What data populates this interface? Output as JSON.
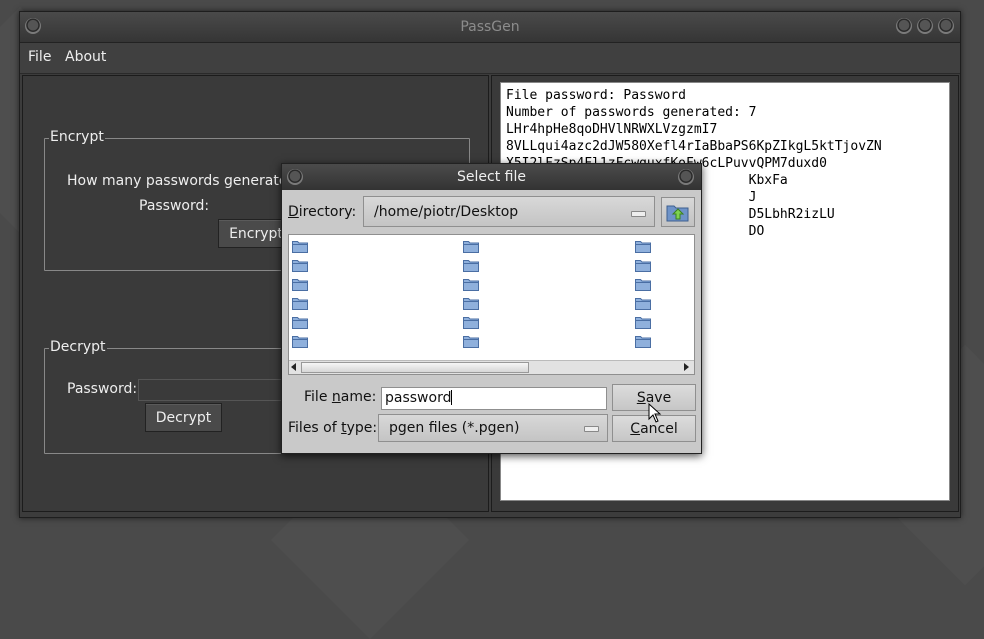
{
  "window": {
    "title": "PassGen"
  },
  "menu": {
    "items": [
      "File",
      "About"
    ]
  },
  "encrypt": {
    "group_title": "Encrypt",
    "count_label": "How many passwords generate?",
    "password_label": "Password:",
    "button_label": "Encrypt"
  },
  "decrypt": {
    "group_title": "Decrypt",
    "password_label": "Password:",
    "button_label": "Decrypt"
  },
  "output": {
    "lines": [
      "File password: Password",
      "Number of passwords generated: 7",
      "LHr4hpHe8qoDHVlNRWXLVzgzmI7",
      "8VLLqui4azc2dJW580Xefl4rIaBbaPS6KpZIkgL5ktTjovZN",
      "X5I2lFzSp4Fl1zFcwquxfKoFw6cLPuvvQPM7duxd0",
      "                               KbxFa",
      "                               J",
      "                               D5LbhR2izLU",
      "                               DO"
    ]
  },
  "dialog": {
    "title": "Select file",
    "directory_label": "Directory:",
    "directory_value": "/home/piotr/Desktop",
    "file_name_label": "File name:",
    "file_name_value": "password",
    "file_type_label": "Files of type:",
    "file_type_value": "pgen files (*.pgen)",
    "save_label": "Save",
    "cancel_label": "Cancel",
    "icons": {
      "up": "folder-up-icon",
      "item": "folder-icon"
    }
  },
  "colors": {
    "window_bg": "#3c3c3c",
    "dialog_bg": "#c9c9c9",
    "output_bg": "#ffffff"
  }
}
